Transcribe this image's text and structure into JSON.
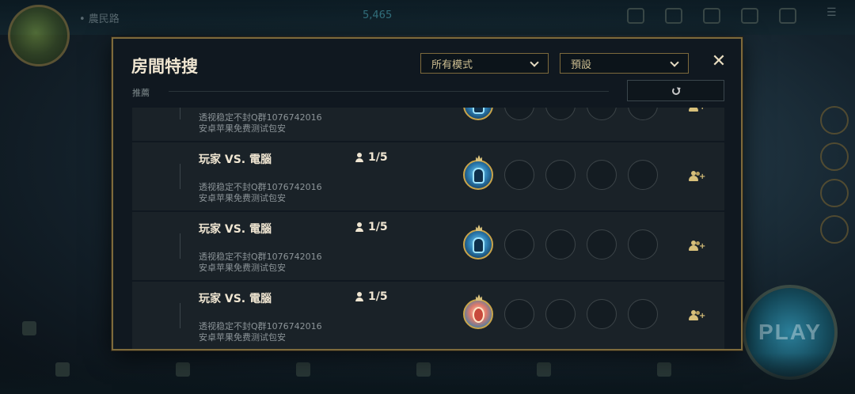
{
  "background": {
    "player_name": "• 農民路",
    "currency": "5,465",
    "play_label": "PLAY"
  },
  "modal": {
    "title": "房間特搜",
    "mode_select": {
      "value": "所有模式"
    },
    "preset_select": {
      "value": "預設"
    },
    "close_label": "✕",
    "recommend_label": "推薦"
  },
  "rooms": [
    {
      "name": "",
      "count": "",
      "desc1": "透视稳定不封Q群1076742016",
      "desc2": "安卓苹果免费测试包安",
      "host_avatar": "blue-bot"
    },
    {
      "name": "玩家 VS. 電腦",
      "count": "1/5",
      "desc1": "透视稳定不封Q群1076742016",
      "desc2": "安卓苹果免费测试包安",
      "host_avatar": "blue-bot"
    },
    {
      "name": "玩家 VS. 電腦",
      "count": "1/5",
      "desc1": "透视稳定不封Q群1076742016",
      "desc2": "安卓苹果免费测试包安",
      "host_avatar": "blue-bot"
    },
    {
      "name": "玩家 VS. 電腦",
      "count": "1/5",
      "desc1": "透视稳定不封Q群1076742016",
      "desc2": "安卓苹果免费测试包安",
      "host_avatar": "red-creature"
    }
  ]
}
